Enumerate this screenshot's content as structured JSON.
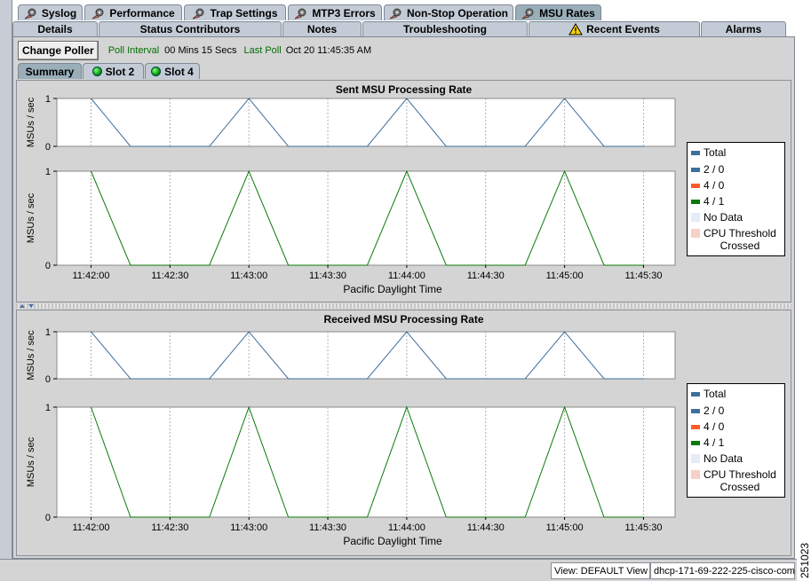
{
  "tabs_row1": [
    {
      "label": "Syslog",
      "icon": "gear-hand-icon"
    },
    {
      "label": "Performance",
      "icon": "gear-hand-icon"
    },
    {
      "label": "Trap Settings",
      "icon": "gear-hand-icon"
    },
    {
      "label": "MTP3 Errors",
      "icon": "gear-hand-icon"
    },
    {
      "label": "Non-Stop Operation",
      "icon": "gear-hand-icon"
    },
    {
      "label": "MSU Rates",
      "icon": "gear-hand-icon",
      "active": true
    }
  ],
  "tabs_row2": [
    {
      "label": "Details"
    },
    {
      "label": "Status Contributors"
    },
    {
      "label": "Notes"
    },
    {
      "label": "Troubleshooting"
    },
    {
      "label": "Recent Events",
      "icon": "warning-icon"
    },
    {
      "label": "Alarms"
    }
  ],
  "toolbar": {
    "change_poller": "Change Poller",
    "poll_interval_label": "Poll Interval",
    "poll_interval_value": "00 Mins 15 Secs",
    "last_poll_label": "Last Poll",
    "last_poll_value": "Oct 20  11:45:35 AM"
  },
  "subtabs": [
    {
      "label": "Summary",
      "active": true
    },
    {
      "label": "Slot 2",
      "icon": "green-status-icon"
    },
    {
      "label": "Slot 4",
      "icon": "green-status-icon"
    }
  ],
  "legend": [
    {
      "label": "Total",
      "color": "#3d6f9c"
    },
    {
      "label": "2 / 0",
      "color": "#3d6f9c"
    },
    {
      "label": "4 / 0",
      "color": "#ff5a2a"
    },
    {
      "label": "4 / 1",
      "color": "#0b7a0b"
    },
    {
      "label": "No Data",
      "color": "#e4ecf7"
    },
    {
      "label": "CPU Threshold\nCrossed",
      "color": "#f8d0c8"
    }
  ],
  "chart_data": [
    {
      "type": "line",
      "title": "Sent MSU Processing Rate",
      "xlabel": "Pacific Daylight Time",
      "x_ticks": [
        "11:42:00",
        "11:42:30",
        "11:43:00",
        "11:43:30",
        "11:44:00",
        "11:44:30",
        "11:45:00",
        "11:45:30"
      ],
      "subplots": [
        {
          "ylabel": "MSUs / sec",
          "ylim": [
            0,
            1
          ],
          "y_ticks": [
            "0",
            "1"
          ],
          "series": [
            {
              "name": "Total",
              "color": "#3d6f9c",
              "x": [
                "11:42:00",
                "11:42:15",
                "11:42:45",
                "11:43:00",
                "11:43:15",
                "11:43:45",
                "11:44:00",
                "11:44:15",
                "11:44:45",
                "11:45:00",
                "11:45:15",
                "11:45:30"
              ],
              "y": [
                1,
                0,
                0,
                1,
                0,
                0,
                1,
                0,
                0,
                1,
                0,
                0
              ]
            }
          ]
        },
        {
          "ylabel": "MSUs / sec",
          "ylim": [
            0,
            1
          ],
          "y_ticks": [
            "0",
            "1"
          ],
          "series": [
            {
              "name": "4 / 1",
              "color": "#0b7a0b",
              "x": [
                "11:42:00",
                "11:42:15",
                "11:42:45",
                "11:43:00",
                "11:43:15",
                "11:43:45",
                "11:44:00",
                "11:44:15",
                "11:44:45",
                "11:45:00",
                "11:45:15",
                "11:45:30"
              ],
              "y": [
                1,
                0,
                0,
                1,
                0,
                0,
                1,
                0,
                0,
                1,
                0,
                0
              ]
            }
          ]
        }
      ]
    },
    {
      "type": "line",
      "title": "Received MSU Processing Rate",
      "xlabel": "Pacific Daylight Time",
      "x_ticks": [
        "11:42:00",
        "11:42:30",
        "11:43:00",
        "11:43:30",
        "11:44:00",
        "11:44:30",
        "11:45:00",
        "11:45:30"
      ],
      "subplots": [
        {
          "ylabel": "MSUs / sec",
          "ylim": [
            0,
            1
          ],
          "y_ticks": [
            "0",
            "1"
          ],
          "series": [
            {
              "name": "Total",
              "color": "#3d6f9c",
              "x": [
                "11:42:00",
                "11:42:15",
                "11:42:45",
                "11:43:00",
                "11:43:15",
                "11:43:45",
                "11:44:00",
                "11:44:15",
                "11:44:45",
                "11:45:00",
                "11:45:15",
                "11:45:30"
              ],
              "y": [
                1,
                0,
                0,
                1,
                0,
                0,
                1,
                0,
                0,
                1,
                0,
                0
              ]
            }
          ]
        },
        {
          "ylabel": "MSUs / sec",
          "ylim": [
            0,
            1
          ],
          "y_ticks": [
            "0",
            "1"
          ],
          "series": [
            {
              "name": "4 / 1",
              "color": "#0b7a0b",
              "x": [
                "11:42:00",
                "11:42:15",
                "11:42:45",
                "11:43:00",
                "11:43:15",
                "11:43:45",
                "11:44:00",
                "11:44:15",
                "11:44:45",
                "11:45:00",
                "11:45:15",
                "11:45:30"
              ],
              "y": [
                1,
                0,
                0,
                1,
                0,
                0,
                1,
                0,
                0,
                1,
                0,
                0
              ]
            }
          ]
        }
      ]
    }
  ],
  "status_bar": {
    "view": "View: DEFAULT View",
    "host": "dhcp-171-69-222-225-cisco-com"
  },
  "figure_id": "251023"
}
